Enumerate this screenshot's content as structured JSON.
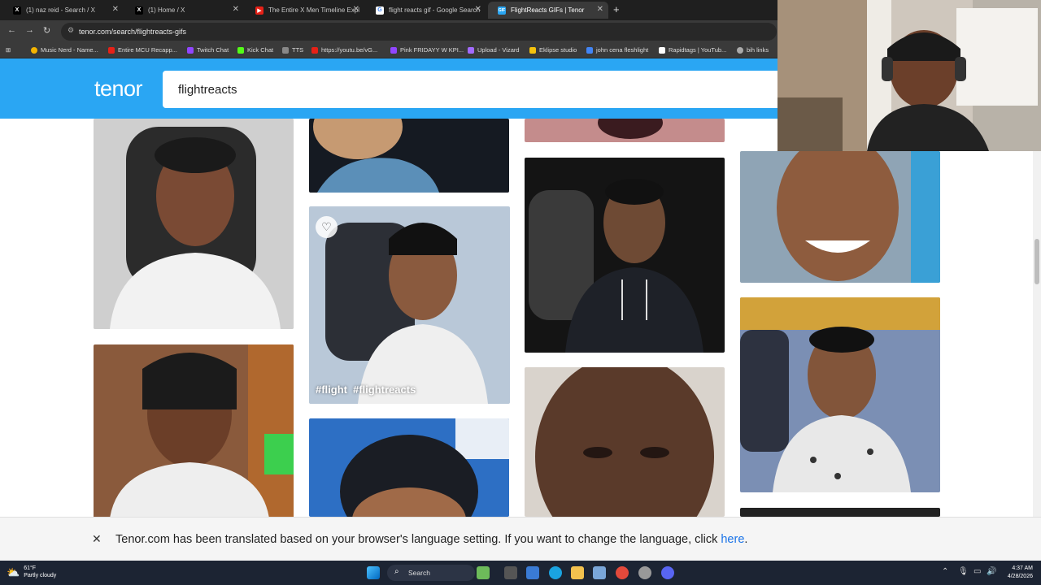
{
  "browser": {
    "tabs": [
      {
        "title": "(1) naz reid - Search / X",
        "icon": "x-logo-icon",
        "active": false
      },
      {
        "title": "(1) Home / X",
        "icon": "x-logo-icon",
        "active": false
      },
      {
        "title": "The Entire X Men Timeline Expl",
        "icon": "youtube-icon",
        "active": false
      },
      {
        "title": "flight reacts gif - Google Search",
        "icon": "google-icon",
        "active": false
      },
      {
        "title": "FlightReacts GIFs | Tenor",
        "icon": "tenor-icon",
        "active": true
      }
    ],
    "url": "tenor.com/search/flightreacts-gifs",
    "bookmarks": [
      "Music Nerd - Name...",
      "Entire MCU Recapp...",
      "Twitch Chat",
      "Kick Chat",
      "TTS",
      "https://youtu.be/vG...",
      "Pink FRIDAYY W KPI...",
      "Upload - Vizard",
      "Eklipse studio",
      "john cena fleshlight",
      "Rapidtags | YouTub...",
      "bih links"
    ]
  },
  "tenor": {
    "logo": "tenor",
    "search_value": "flightreacts",
    "hovered_gif_tags": [
      "#flight",
      "#flightreacts"
    ]
  },
  "translation_bar": {
    "message": "Tenor.com has been translated based on your browser's language setting. If you want to change the language, click ",
    "link": "here",
    "suffix": "."
  },
  "taskbar": {
    "weather_temp": "61°F",
    "weather_desc": "Partly cloudy",
    "search_label": "Search",
    "time": "4:37 AM",
    "date": "4/28/2026"
  },
  "colors": {
    "tenor_blue": "#2aa6f3",
    "link_blue": "#1a73e8",
    "taskbar": "#1c2433"
  }
}
